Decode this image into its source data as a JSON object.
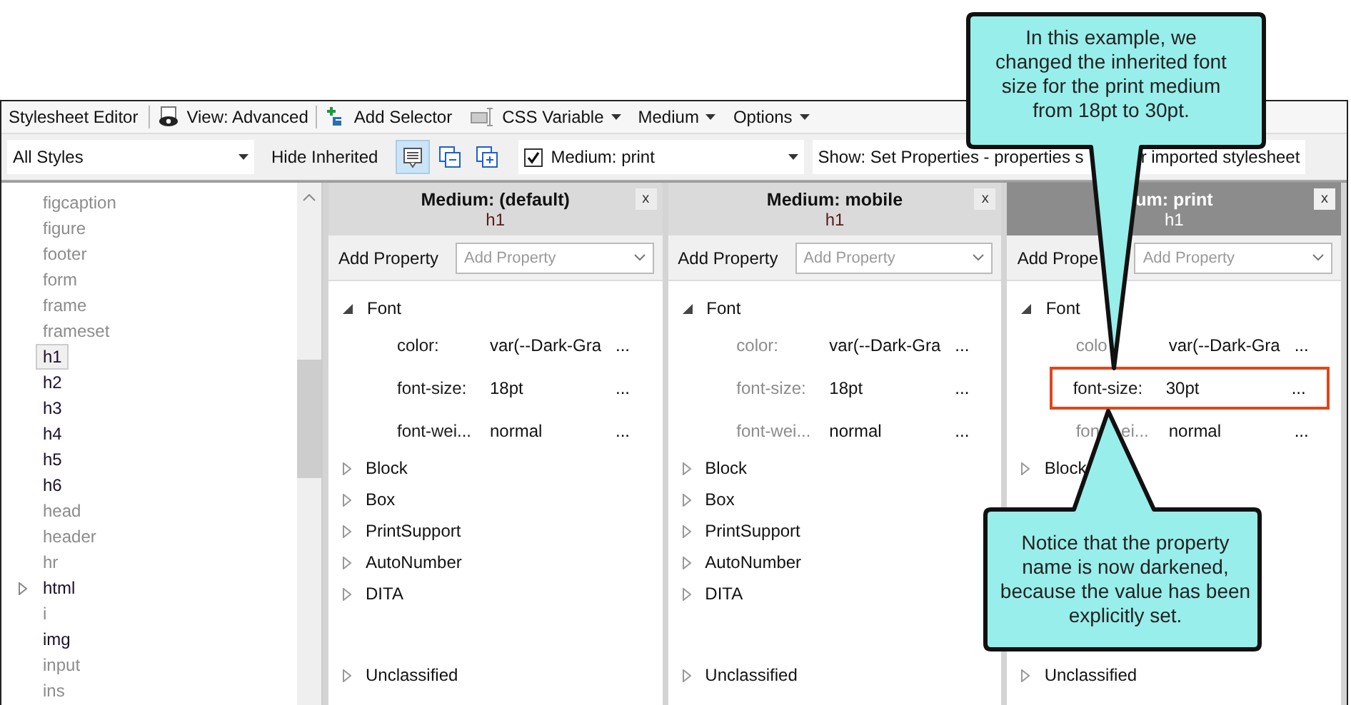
{
  "toolbar": {
    "title": "Stylesheet Editor",
    "items": [
      {
        "label": "View: Advanced",
        "kind": "eye",
        "menu": false
      },
      {
        "label": "Add Selector",
        "kind": "add",
        "menu": false
      },
      {
        "label": "CSS Variable",
        "kind": "variable",
        "menu": true
      },
      {
        "label": "Medium",
        "kind": "text",
        "menu": true
      },
      {
        "label": "Options",
        "kind": "text",
        "menu": true
      }
    ]
  },
  "filter_bar": {
    "style_filter": "All Styles",
    "hide_inherited": "Hide Inherited",
    "view_buttons": [
      {
        "kind": "list",
        "selected": true
      },
      {
        "kind": "collapse",
        "selected": false
      },
      {
        "kind": "expand",
        "selected": false
      }
    ],
    "medium": {
      "checked": true,
      "label": "Medium: print"
    },
    "show_text": [
      "Show: Set Properties - properties s",
      "r imported stylesheet"
    ]
  },
  "selectors": [
    {
      "name": "figcaption",
      "styled": false,
      "selected": false
    },
    {
      "name": "figure",
      "styled": false,
      "selected": false
    },
    {
      "name": "footer",
      "styled": false,
      "selected": false
    },
    {
      "name": "form",
      "styled": false,
      "selected": false
    },
    {
      "name": "frame",
      "styled": false,
      "selected": false
    },
    {
      "name": "frameset",
      "styled": false,
      "selected": false
    },
    {
      "name": "h1",
      "styled": true,
      "selected": true
    },
    {
      "name": "h2",
      "styled": true,
      "selected": false
    },
    {
      "name": "h3",
      "styled": true,
      "selected": false
    },
    {
      "name": "h4",
      "styled": true,
      "selected": false
    },
    {
      "name": "h5",
      "styled": true,
      "selected": false
    },
    {
      "name": "h6",
      "styled": true,
      "selected": false
    },
    {
      "name": "head",
      "styled": false,
      "selected": false
    },
    {
      "name": "header",
      "styled": false,
      "selected": false
    },
    {
      "name": "hr",
      "styled": false,
      "selected": false
    },
    {
      "name": "html",
      "styled": true,
      "selected": false,
      "has_children": true
    },
    {
      "name": "i",
      "styled": false,
      "selected": false
    },
    {
      "name": "img",
      "styled": true,
      "selected": false
    },
    {
      "name": "input",
      "styled": false,
      "selected": false
    },
    {
      "name": "ins",
      "styled": false,
      "selected": false
    }
  ],
  "panels": [
    {
      "title": "Medium: (default)",
      "selector": "h1",
      "selected": false,
      "close": "x",
      "add_label": "Add Property",
      "add_placeholder": "Add Property",
      "groups": [
        {
          "name": "Font",
          "expanded": true,
          "properties": [
            {
              "name": "color:",
              "value": "var(--Dark-Gra",
              "inherited": false,
              "highlighted": false,
              "more": "..."
            },
            {
              "name": "font-size:",
              "value": "18pt",
              "inherited": false,
              "highlighted": false,
              "more": "..."
            },
            {
              "name": "font-wei...",
              "value": "normal",
              "inherited": false,
              "highlighted": false,
              "more": "..."
            }
          ]
        },
        {
          "name": "Block",
          "expanded": false
        },
        {
          "name": "Box",
          "expanded": false
        },
        {
          "name": "PrintSupport",
          "expanded": false
        },
        {
          "name": "AutoNumber",
          "expanded": false
        },
        {
          "name": "DITA",
          "expanded": false
        },
        {
          "name": "Unclassified",
          "expanded": false
        }
      ]
    },
    {
      "title": "Medium: mobile",
      "selector": "h1",
      "selected": false,
      "close": "x",
      "add_label": "Add Property",
      "add_placeholder": "Add Property",
      "groups": [
        {
          "name": "Font",
          "expanded": true,
          "properties": [
            {
              "name": "color:",
              "value": "var(--Dark-Gra",
              "inherited": true,
              "highlighted": false,
              "more": "..."
            },
            {
              "name": "font-size:",
              "value": "18pt",
              "inherited": true,
              "highlighted": false,
              "more": "..."
            },
            {
              "name": "font-wei...",
              "value": "normal",
              "inherited": true,
              "highlighted": false,
              "more": "..."
            }
          ]
        },
        {
          "name": "Block",
          "expanded": false
        },
        {
          "name": "Box",
          "expanded": false
        },
        {
          "name": "PrintSupport",
          "expanded": false
        },
        {
          "name": "AutoNumber",
          "expanded": false
        },
        {
          "name": "DITA",
          "expanded": false
        },
        {
          "name": "Unclassified",
          "expanded": false
        }
      ]
    },
    {
      "title": "um: print",
      "selector": "h1",
      "selected": true,
      "close": "x",
      "add_label": "Add Prope",
      "add_placeholder": "Add Property",
      "groups": [
        {
          "name": "Font",
          "expanded": true,
          "properties": [
            {
              "name": "colo",
              "value": "var(--Dark-Gra",
              "inherited": true,
              "highlighted": false,
              "more": "..."
            },
            {
              "name": "font-size:",
              "value": "30pt",
              "inherited": false,
              "highlighted": true,
              "more": "..."
            },
            {
              "name": "fon",
              "name_rest": "ei...",
              "value": "normal",
              "inherited": true,
              "highlighted": false,
              "more": "..."
            }
          ]
        },
        {
          "name": "Block",
          "expanded": false
        },
        {
          "name": "Unclassified",
          "expanded": false
        }
      ]
    }
  ],
  "callouts": [
    {
      "text": "In this example, we changed the inherited font size for the print medium from 18pt to 30pt."
    },
    {
      "text": "Notice that the property name is now darkened, because the value has been explicitly set."
    }
  ]
}
